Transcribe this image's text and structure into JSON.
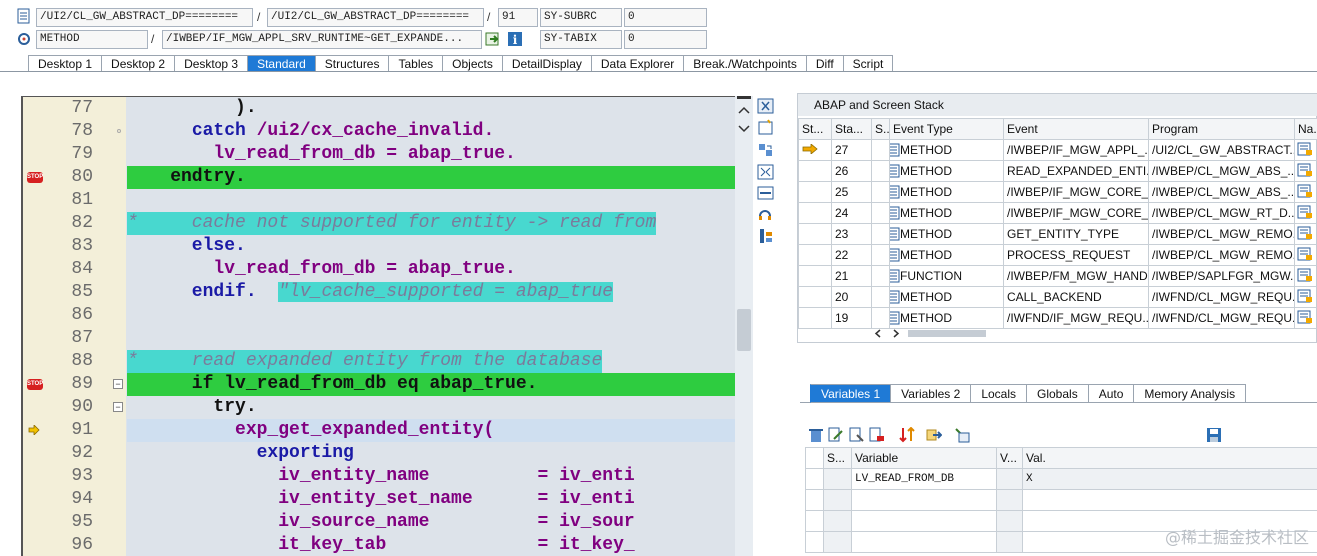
{
  "header": {
    "row1": {
      "program": "/UI2/CL_GW_ABSTRACT_DP========",
      "include": "/UI2/CL_GW_ABSTRACT_DP========",
      "line": "91",
      "sysfield": "SY-SUBRC",
      "sysvalue": "0"
    },
    "row2": {
      "event_type": "METHOD",
      "event": "/IWBEP/IF_MGW_APPL_SRV_RUNTIME~GET_EXPANDE...",
      "sysfield": "SY-TABIX",
      "sysvalue": "0"
    },
    "sep": "/"
  },
  "tabs": [
    "Desktop 1",
    "Desktop 2",
    "Desktop 3",
    "Standard",
    "Structures",
    "Tables",
    "Objects",
    "DetailDisplay",
    "Data Explorer",
    "Break./Watchpoints",
    "Diff",
    "Script"
  ],
  "code_lines": [
    {
      "n": "77",
      "text": "          ).",
      "style": "blk",
      "hl": ""
    },
    {
      "n": "78",
      "text": "      catch /ui2/cx_cache_invalid.",
      "style": "mix_catch",
      "hl": ""
    },
    {
      "n": "79",
      "text": "        lv_read_from_db = abap_true.",
      "style": "var",
      "hl": ""
    },
    {
      "n": "80",
      "text": "    endtry.",
      "style": "blk",
      "hl": "green",
      "bp": true
    },
    {
      "n": "81",
      "text": "",
      "style": "blk",
      "hl": ""
    },
    {
      "n": "82",
      "text": "*     cache not supported for entity -> read from",
      "style": "cmt",
      "hl": "teal"
    },
    {
      "n": "83",
      "text": "      else.",
      "style": "kw",
      "hl": ""
    },
    {
      "n": "84",
      "text": "        lv_read_from_db = abap_true.",
      "style": "var",
      "hl": ""
    },
    {
      "n": "85",
      "text": "      endif.  \"lv_cache_supported = abap_true",
      "style": "mix_endif",
      "hl": ""
    },
    {
      "n": "86",
      "text": "",
      "style": "blk",
      "hl": ""
    },
    {
      "n": "87",
      "text": "",
      "style": "blk",
      "hl": ""
    },
    {
      "n": "88",
      "text": "*     read expanded entity from the database",
      "style": "cmt",
      "hl": "teal"
    },
    {
      "n": "89",
      "text": "      if lv_read_from_db eq abap_true.",
      "style": "blk",
      "hl": "green",
      "bp": true
    },
    {
      "n": "90",
      "text": "        try.",
      "style": "blk",
      "hl": ""
    },
    {
      "n": "91",
      "text": "          exp_get_expanded_entity(",
      "style": "var",
      "hl": "",
      "cur": true
    },
    {
      "n": "92",
      "text": "            exporting",
      "style": "kw",
      "hl": ""
    },
    {
      "n": "93",
      "text": "              iv_entity_name          = iv_enti",
      "style": "var",
      "hl": ""
    },
    {
      "n": "94",
      "text": "              iv_entity_set_name      = iv_enti",
      "style": "var",
      "hl": ""
    },
    {
      "n": "95",
      "text": "              iv_source_name          = iv_sour",
      "style": "var",
      "hl": ""
    },
    {
      "n": "96",
      "text": "              it_key_tab              = it_key_",
      "style": "var",
      "hl": ""
    }
  ],
  "bp_label": "STOP",
  "stack": {
    "title": "ABAP and Screen Stack",
    "columns": [
      "St...",
      "Sta...",
      "S...",
      "Event Type",
      "Event",
      "Program",
      "Na..."
    ],
    "rows": [
      {
        "level": "27",
        "type": "METHOD",
        "event": "/IWBEP/IF_MGW_APPL_...",
        "program": "/UI2/CL_GW_ABSTRACT...",
        "cur": true
      },
      {
        "level": "26",
        "type": "METHOD",
        "event": "READ_EXPANDED_ENTI...",
        "program": "/IWBEP/CL_MGW_ABS_..."
      },
      {
        "level": "25",
        "type": "METHOD",
        "event": "/IWBEP/IF_MGW_CORE_...",
        "program": "/IWBEP/CL_MGW_ABS_..."
      },
      {
        "level": "24",
        "type": "METHOD",
        "event": "/IWBEP/IF_MGW_CORE_...",
        "program": "/IWBEP/CL_MGW_RT_D..."
      },
      {
        "level": "23",
        "type": "METHOD",
        "event": "GET_ENTITY_TYPE",
        "program": "/IWBEP/CL_MGW_REMO..."
      },
      {
        "level": "22",
        "type": "METHOD",
        "event": "PROCESS_REQUEST",
        "program": "/IWBEP/CL_MGW_REMO..."
      },
      {
        "level": "21",
        "type": "FUNCTION",
        "event": "/IWBEP/FM_MGW_HAND...",
        "program": "/IWBEP/SAPLFGR_MGW..."
      },
      {
        "level": "20",
        "type": "METHOD",
        "event": "CALL_BACKEND",
        "program": "/IWFND/CL_MGW_REQU..."
      },
      {
        "level": "19",
        "type": "METHOD",
        "event": "/IWFND/IF_MGW_REQU...",
        "program": "/IWFND/CL_MGW_REQU..."
      }
    ]
  },
  "var_tabs": [
    "Variables 1",
    "Variables 2",
    "Locals",
    "Globals",
    "Auto",
    "Memory Analysis"
  ],
  "var_table": {
    "columns": [
      "S...",
      "Variable",
      "V...",
      "Val."
    ],
    "rows": [
      {
        "name": "LV_READ_FROM_DB",
        "value": "X"
      }
    ]
  },
  "watermark": "@稀土掘金技术社区"
}
